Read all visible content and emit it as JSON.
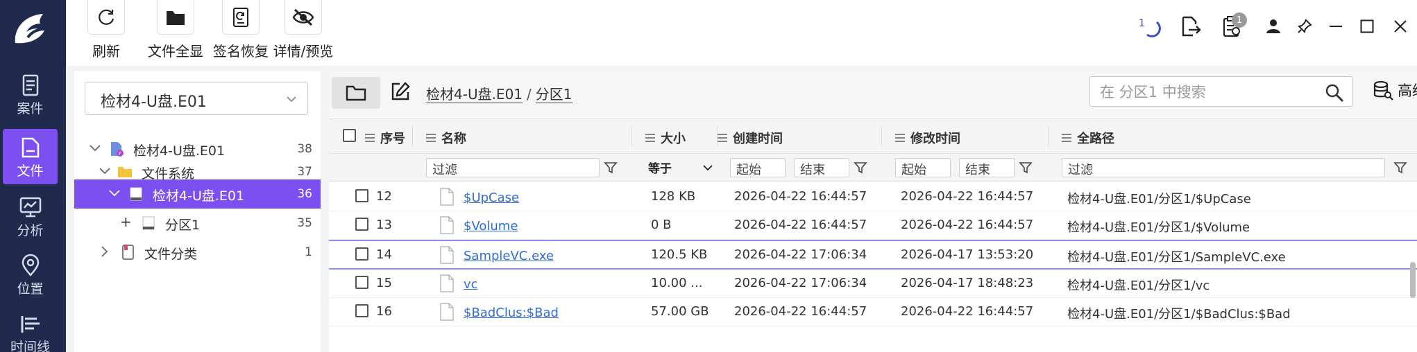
{
  "nav": {
    "items": [
      {
        "label": "案件",
        "icon": "case-icon"
      },
      {
        "label": "文件",
        "icon": "file-icon",
        "active": true
      },
      {
        "label": "分析",
        "icon": "analysis-icon"
      },
      {
        "label": "位置",
        "icon": "location-icon"
      },
      {
        "label": "时间线",
        "icon": "timeline-icon"
      }
    ]
  },
  "toolbar": {
    "refresh_label": "刷新",
    "show_all_label": "文件全显",
    "signature_label": "签名恢复",
    "details_label": "详情/预览",
    "spinner_text": "1",
    "task_badge": "1"
  },
  "tree": {
    "dropdown_value": "检材4-U盘.E01",
    "nodes": [
      {
        "label": "检材4-U盘.E01",
        "count": "38",
        "expand": "v"
      },
      {
        "label": "文件系统",
        "count": "37",
        "expand": "v"
      },
      {
        "label": "检材4-U盘.E01",
        "count": "36",
        "expand": "v",
        "selected": true
      },
      {
        "label": "分区1",
        "count": "35",
        "expand": "+"
      },
      {
        "label": "文件分类",
        "count": "1",
        "expand": ">"
      }
    ]
  },
  "path": {
    "crumb1": "检材4-U盘.E01",
    "separator": "/",
    "crumb2": "分区1"
  },
  "search": {
    "placeholder": "在 分区1 中搜索",
    "advanced_label": "高级"
  },
  "table": {
    "headers": {
      "index": "序号",
      "name": "名称",
      "size": "大小",
      "created": "创建时间",
      "modified": "修改时间",
      "fullpath": "全路径"
    },
    "filters": {
      "name": "过滤",
      "size_op": "等于",
      "created_start": "起始",
      "created_end": "结束",
      "modified_start": "起始",
      "modified_end": "结束",
      "fullpath": "过滤"
    },
    "rows": [
      {
        "index": "12",
        "name": "$UpCase",
        "size": "128 KB",
        "created": "2026-04-22 16:44:57",
        "modified": "2026-04-22 16:44:57",
        "path": "检材4-U盘.E01/分区1/$UpCase"
      },
      {
        "index": "13",
        "name": "$Volume",
        "size": "0 B",
        "created": "2026-04-22 16:44:57",
        "modified": "2026-04-22 16:44:57",
        "path": "检材4-U盘.E01/分区1/$Volume"
      },
      {
        "index": "14",
        "name": "SampleVC.exe",
        "size": "120.5 KB",
        "created": "2026-04-22 17:06:34",
        "modified": "2026-04-17 13:53:20",
        "path": "检材4-U盘.E01/分区1/SampleVC.exe"
      },
      {
        "index": "15",
        "name": "vc",
        "size": "10.00 ...",
        "created": "2026-04-22 17:06:34",
        "modified": "2026-04-17 18:48:23",
        "path": "检材4-U盘.E01/分区1/vc"
      },
      {
        "index": "16",
        "name": "$BadClus:$Bad",
        "size": "57.00 GB",
        "created": "2026-04-22 16:44:57",
        "modified": "2026-04-22 16:44:57",
        "path": "检材4-U盘.E01/分区1/$BadClus:$Bad"
      }
    ]
  },
  "colors": {
    "rail": "#1f2a4c",
    "accent": "#7b4ff0",
    "link": "#2d6cdf"
  }
}
